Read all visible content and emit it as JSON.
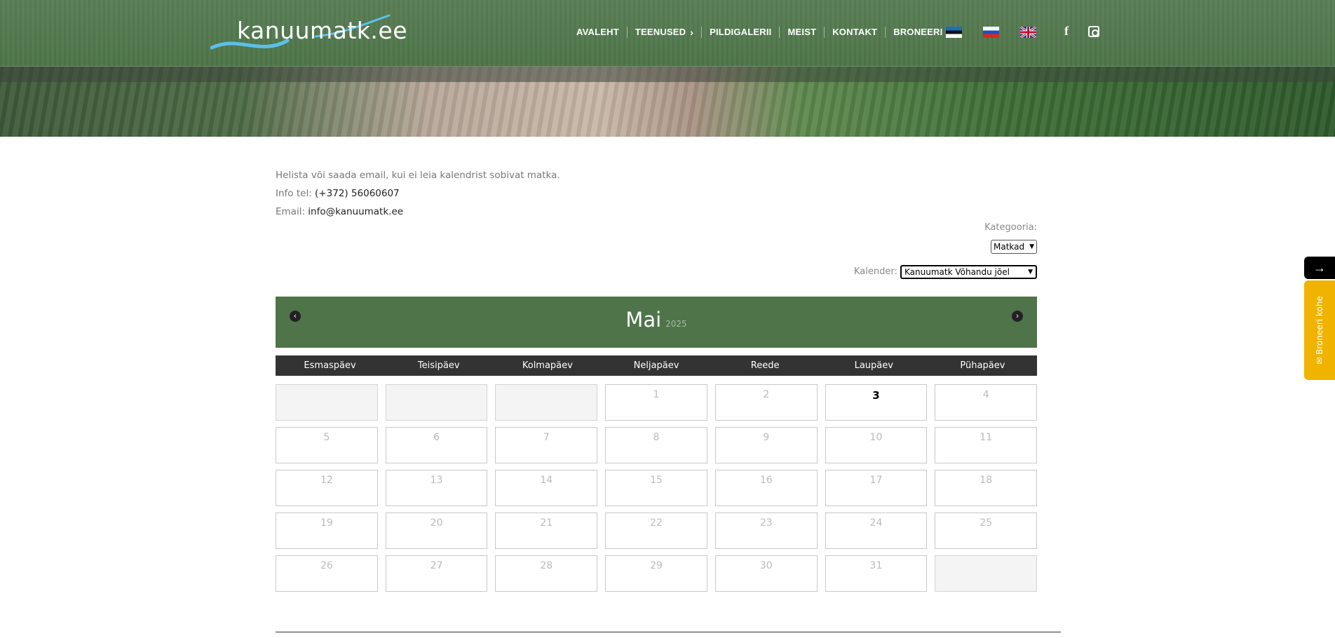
{
  "header": {
    "logo_text": "kanuumatk.ee",
    "nav": [
      {
        "label": "AVALEHT"
      },
      {
        "label": "TEENUSED"
      },
      {
        "label": "PILDIGALERII"
      },
      {
        "label": "MEIST"
      },
      {
        "label": "KONTAKT"
      },
      {
        "label": "BRONEERI"
      }
    ]
  },
  "info": {
    "line1": "Helista või saada email, kui ei leia kalendrist sobivat matka.",
    "tel_label": "Info tel: ",
    "tel_value": "(+372) 56060607",
    "email_label": "Email: ",
    "email_value": "info@kanuumatk.ee"
  },
  "filters": {
    "category_label": "Kategooria:",
    "category_value": "Matkad",
    "calendar_label": "Kalender:",
    "calendar_value": "Kanuumatk Võhandu jõel"
  },
  "calendar": {
    "month": "Mai",
    "year": "2025",
    "weekdays": [
      "Esmaspäev",
      "Teisipäev",
      "Kolmapäev",
      "Neljapäev",
      "Reede",
      "Laupäev",
      "Pühapäev"
    ],
    "weeks": [
      [
        "",
        "",
        "",
        "1",
        "2",
        "3",
        "4"
      ],
      [
        "5",
        "6",
        "7",
        "8",
        "9",
        "10",
        "11"
      ],
      [
        "12",
        "13",
        "14",
        "15",
        "16",
        "17",
        "18"
      ],
      [
        "19",
        "20",
        "21",
        "22",
        "23",
        "24",
        "25"
      ],
      [
        "26",
        "27",
        "28",
        "29",
        "30",
        "31",
        ""
      ]
    ],
    "today": "3"
  },
  "side_tab": {
    "arrow": "→",
    "label": "✉ Broneeri kohe"
  },
  "colors": {
    "header_green": "#4f744a",
    "weekday_bar": "#333333",
    "booking_tab": "#f0b400"
  }
}
